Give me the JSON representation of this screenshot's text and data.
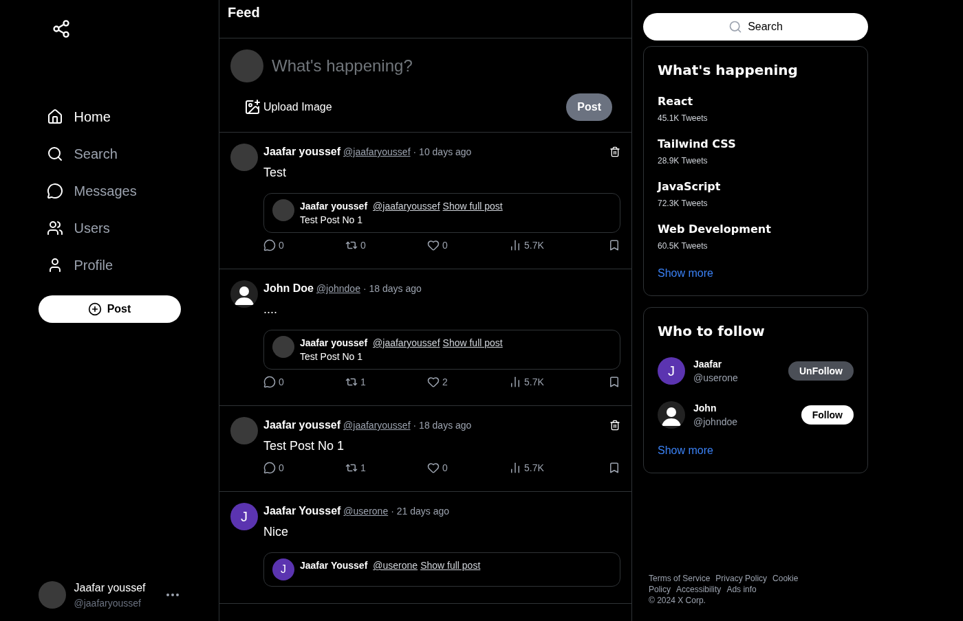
{
  "nav": {
    "items": [
      {
        "label": "Home",
        "selected": true
      },
      {
        "label": "Search",
        "selected": false
      },
      {
        "label": "Messages",
        "selected": false
      },
      {
        "label": "Users",
        "selected": false
      },
      {
        "label": "Profile",
        "selected": false
      }
    ],
    "post_button": "Post"
  },
  "account": {
    "name": "Jaafar youssef",
    "handle": "@jaafaryoussef"
  },
  "feed": {
    "title": "Feed",
    "composer": {
      "placeholder": "What's happening?",
      "upload_label": "Upload Image",
      "post_label": "Post"
    },
    "posts": [
      {
        "avatar": {
          "kind": "photo"
        },
        "author": "Jaafar youssef",
        "handle": "@jaafaryoussef",
        "time": "· 10 days ago",
        "text": "Test",
        "deletable": true,
        "quote": {
          "avatar": {
            "kind": "photo"
          },
          "author": "Jaafar youssef",
          "handle": "@jaafaryoussef",
          "link": "Show full post",
          "text": "Test Post No 1"
        },
        "stats": {
          "comments": "0",
          "reposts": "0",
          "likes": "0",
          "views": "5.7K"
        }
      },
      {
        "avatar": {
          "kind": "default"
        },
        "author": "John Doe",
        "handle": "@johndoe",
        "time": "· 18 days ago",
        "text": "....",
        "deletable": false,
        "quote": {
          "avatar": {
            "kind": "photo"
          },
          "author": "Jaafar youssef",
          "handle": "@jaafaryoussef",
          "link": "Show full post",
          "text": "Test Post No 1"
        },
        "stats": {
          "comments": "0",
          "reposts": "1",
          "likes": "2",
          "views": "5.7K"
        }
      },
      {
        "avatar": {
          "kind": "photo"
        },
        "author": "Jaafar youssef",
        "handle": "@jaafaryoussef",
        "time": "· 18 days ago",
        "text": "Test Post No 1",
        "deletable": true,
        "stats": {
          "comments": "0",
          "reposts": "1",
          "likes": "0",
          "views": "5.7K"
        }
      },
      {
        "avatar": {
          "kind": "letter",
          "letter": "J",
          "color": "#5b34b0"
        },
        "author": "Jaafar Youssef",
        "handle": "@userone",
        "time": "· 21 days ago",
        "text": "Nice",
        "deletable": false,
        "quote": {
          "avatar": {
            "kind": "letter",
            "letter": "J",
            "color": "#5b34b0"
          },
          "author": "Jaafar Youssef",
          "handle": "@userone",
          "link": "Show full post"
        }
      }
    ]
  },
  "search": {
    "placeholder": "Search"
  },
  "trends": {
    "title": "What's happening",
    "items": [
      {
        "topic": "React",
        "count": "45.1K Tweets"
      },
      {
        "topic": "Tailwind CSS",
        "count": "28.9K Tweets"
      },
      {
        "topic": "JavaScript",
        "count": "72.3K Tweets"
      },
      {
        "topic": "Web Development",
        "count": "60.5K Tweets"
      }
    ],
    "show_more": "Show more"
  },
  "who_to_follow": {
    "title": "Who to follow",
    "users": [
      {
        "avatar": {
          "kind": "letter",
          "letter": "J",
          "color": "#5b34b0"
        },
        "name": "Jaafar",
        "handle": "@userone",
        "button": "UnFollow",
        "following": true
      },
      {
        "avatar": {
          "kind": "default"
        },
        "name": "John",
        "handle": "@johndoe",
        "button": "Follow",
        "following": false
      }
    ],
    "show_more": "Show more"
  },
  "footer": [
    "Terms of Service",
    "Privacy Policy",
    "Cookie",
    "Policy",
    "Accessibility",
    "Ads info",
    "© 2024 X Corp."
  ]
}
